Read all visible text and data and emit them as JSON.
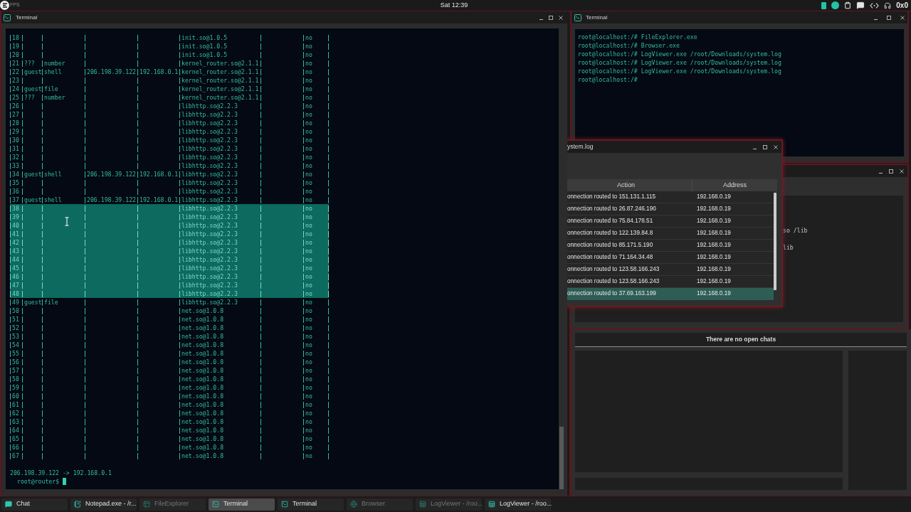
{
  "top_bar": {
    "fps_label": "FPS",
    "clock": "Sat 12:39",
    "status_text": "0x0"
  },
  "main_terminal": {
    "title": "Terminal",
    "rows": [
      {
        "column_1": "18",
        "column_6": "init.so@1.0.5",
        "column_8": "no",
        "selected": false
      },
      {
        "column_1": "19",
        "column_6": "init.so@1.0.5",
        "column_8": "no",
        "selected": false
      },
      {
        "column_1": "20",
        "column_6": "init.so@1.0.5",
        "column_8": "no",
        "selected": false
      },
      {
        "column_1": "21",
        "column_2": "???",
        "column_3": "number",
        "column_6": "kernel_router.so@2.1.1",
        "column_8": "no",
        "selected": false
      },
      {
        "column_1": "22",
        "column_2": "guest",
        "column_3": "shell",
        "column_4": "206.198.39.122",
        "column_5": "192.168.0.1",
        "column_6": "kernel_router.so@2.1.1",
        "column_8": "no",
        "selected": false
      },
      {
        "column_1": "23",
        "column_6": "kernel_router.so@2.1.1",
        "column_8": "no",
        "selected": false
      },
      {
        "column_1": "24",
        "column_2": "guest",
        "column_3": "file",
        "column_6": "kernel_router.so@2.1.1",
        "column_8": "no",
        "selected": false
      },
      {
        "column_1": "25",
        "column_2": "???",
        "column_3": "number",
        "column_6": "kernel_router.so@2.1.1",
        "column_8": "no",
        "selected": false
      },
      {
        "column_1": "26",
        "column_6": "libhttp.so@2.2.3",
        "column_8": "no",
        "selected": false
      },
      {
        "column_1": "27",
        "column_6": "libhttp.so@2.2.3",
        "column_8": "no",
        "selected": false
      },
      {
        "column_1": "28",
        "column_6": "libhttp.so@2.2.3",
        "column_8": "no",
        "selected": false
      },
      {
        "column_1": "29",
        "column_6": "libhttp.so@2.2.3",
        "column_8": "no",
        "selected": false
      },
      {
        "column_1": "30",
        "column_6": "libhttp.so@2.2.3",
        "column_8": "no",
        "selected": false
      },
      {
        "column_1": "31",
        "column_6": "libhttp.so@2.2.3",
        "column_8": "no",
        "selected": false
      },
      {
        "column_1": "32",
        "column_6": "libhttp.so@2.2.3",
        "column_8": "no",
        "selected": false
      },
      {
        "column_1": "33",
        "column_6": "libhttp.so@2.2.3",
        "column_8": "no",
        "selected": false
      },
      {
        "column_1": "34",
        "column_2": "guest",
        "column_3": "shell",
        "column_4": "206.198.39.122",
        "column_5": "192.168.0.1",
        "column_6": "libhttp.so@2.2.3",
        "column_8": "no",
        "selected": false
      },
      {
        "column_1": "35",
        "column_6": "libhttp.so@2.2.3",
        "column_8": "no",
        "selected": false
      },
      {
        "column_1": "36",
        "column_6": "libhttp.so@2.2.3",
        "column_8": "no",
        "selected": false
      },
      {
        "column_1": "37",
        "column_2": "guest",
        "column_3": "shell",
        "column_4": "206.198.39.122",
        "column_5": "192.168.0.1",
        "column_6": "libhttp.so@2.2.3",
        "column_8": "no",
        "selected": false
      },
      {
        "column_1": "38",
        "column_6": "libhttp.so@2.2.3",
        "column_8": "no",
        "selected": true
      },
      {
        "column_1": "39",
        "column_6": "libhttp.so@2.2.3",
        "column_8": "no",
        "selected": true
      },
      {
        "column_1": "40",
        "column_6": "libhttp.so@2.2.3",
        "column_8": "no",
        "selected": true
      },
      {
        "column_1": "41",
        "column_6": "libhttp.so@2.2.3",
        "column_8": "no",
        "selected": true
      },
      {
        "column_1": "42",
        "column_6": "libhttp.so@2.2.3",
        "column_8": "no",
        "selected": true
      },
      {
        "column_1": "43",
        "column_6": "libhttp.so@2.2.3",
        "column_8": "no",
        "selected": true
      },
      {
        "column_1": "44",
        "column_6": "libhttp.so@2.2.3",
        "column_8": "no",
        "selected": true
      },
      {
        "column_1": "45",
        "column_6": "libhttp.so@2.2.3",
        "column_8": "no",
        "selected": true
      },
      {
        "column_1": "46",
        "column_6": "libhttp.so@2.2.3",
        "column_8": "no",
        "selected": true
      },
      {
        "column_1": "47",
        "column_6": "libhttp.so@2.2.3",
        "column_8": "no",
        "selected": true
      },
      {
        "column_1": "48",
        "column_6": "libhttp.so@2.2.3",
        "column_8": "no",
        "selected": true
      },
      {
        "column_1": "49",
        "column_2": "guest",
        "column_3": "file",
        "column_6": "libhttp.so@2.2.3",
        "column_8": "no",
        "selected": false
      },
      {
        "column_1": "50",
        "column_6": "net.so@1.0.8",
        "column_8": "no",
        "selected": false
      },
      {
        "column_1": "51",
        "column_6": "net.so@1.0.8",
        "column_8": "no",
        "selected": false
      },
      {
        "column_1": "52",
        "column_6": "net.so@1.0.8",
        "column_8": "no",
        "selected": false
      },
      {
        "column_1": "53",
        "column_6": "net.so@1.0.8",
        "column_8": "no",
        "selected": false
      },
      {
        "column_1": "54",
        "column_6": "net.so@1.0.8",
        "column_8": "no",
        "selected": false
      },
      {
        "column_1": "55",
        "column_6": "net.so@1.0.8",
        "column_8": "no",
        "selected": false
      },
      {
        "column_1": "56",
        "column_6": "net.so@1.0.8",
        "column_8": "no",
        "selected": false
      },
      {
        "column_1": "57",
        "column_6": "net.so@1.0.8",
        "column_8": "no",
        "selected": false
      },
      {
        "column_1": "58",
        "column_6": "net.so@1.0.8",
        "column_8": "no",
        "selected": false
      },
      {
        "column_1": "59",
        "column_6": "net.so@1.0.8",
        "column_8": "no",
        "selected": false
      },
      {
        "column_1": "60",
        "column_6": "net.so@1.0.8",
        "column_8": "no",
        "selected": false
      },
      {
        "column_1": "61",
        "column_6": "net.so@1.0.8",
        "column_8": "no",
        "selected": false
      },
      {
        "column_1": "62",
        "column_6": "net.so@1.0.8",
        "column_8": "no",
        "selected": false
      },
      {
        "column_1": "63",
        "column_6": "net.so@1.0.8",
        "column_8": "no",
        "selected": false
      },
      {
        "column_1": "64",
        "column_6": "net.so@1.0.8",
        "column_8": "no",
        "selected": false
      },
      {
        "column_1": "65",
        "column_6": "net.so@1.0.8",
        "column_8": "no",
        "selected": false
      },
      {
        "column_1": "66",
        "column_6": "net.so@1.0.8",
        "column_8": "no",
        "selected": false
      },
      {
        "column_1": "67",
        "column_6": "net.so@1.0.8",
        "column_8": "no",
        "selected": false
      }
    ],
    "output": "206.198.39.122 -> 192.168.0.1",
    "prompt": "root@router$"
  },
  "side_terminal": {
    "title": "Terminal",
    "lines": [
      "root@localhost:/# FileExplorer.exe",
      "root@localhost:/# Browser.exe",
      "root@localhost:/# LogViewer.exe /root/Downloads/system.log",
      "root@localhost:/# LogViewer.exe /root/Downloads/system.log",
      "root@localhost:/# LogViewer.exe /root/Downloads/system.log",
      "root@localhost:/#"
    ]
  },
  "background_window": {
    "lines": [
      "so /lib",
      "lib"
    ]
  },
  "log_viewer": {
    "title": "ystem.log",
    "columns": [
      "Action",
      "Address"
    ],
    "rows": [
      {
        "action": "onnection routed to 151.131.1.115",
        "address": "192.168.0.19",
        "selected": false
      },
      {
        "action": "onnection routed to 26.87.246.190",
        "address": "192.168.0.19",
        "selected": false
      },
      {
        "action": "onnection routed to 75.84.178.51",
        "address": "192.168.0.19",
        "selected": false
      },
      {
        "action": "onnection routed to 122.139.84.8",
        "address": "192.168.0.19",
        "selected": false
      },
      {
        "action": "onnection routed to 85.171.5.190",
        "address": "192.168.0.19",
        "selected": false
      },
      {
        "action": "onnection routed to 71.164.34.48",
        "address": "192.168.0.19",
        "selected": false
      },
      {
        "action": "onnection routed to 123.58.166.243",
        "address": "192.168.0.19",
        "selected": false
      },
      {
        "action": "onnection routed to 123.58.166.243",
        "address": "192.168.0.19",
        "selected": false
      },
      {
        "action": "onnection routed to 37.69.163.199",
        "address": "192.168.0.19",
        "selected": true
      }
    ]
  },
  "chat_window": {
    "header": "There are no open chats"
  },
  "taskbar": {
    "items": [
      {
        "label": "Chat",
        "kind": "chat",
        "selected": false,
        "minimized": false
      },
      {
        "label": "Notepad.exe - /r...",
        "kind": "notepad",
        "selected": false,
        "minimized": false
      },
      {
        "label": "FileExplorer",
        "kind": "explorer",
        "selected": false,
        "minimized": true
      },
      {
        "label": "Terminal",
        "kind": "terminal",
        "selected": true,
        "minimized": false
      },
      {
        "label": "Terminal",
        "kind": "terminal",
        "selected": false,
        "minimized": false
      },
      {
        "label": "Browser",
        "kind": "browser",
        "selected": false,
        "minimized": true
      },
      {
        "label": "LogViewer - /roo...",
        "kind": "logviewer",
        "selected": false,
        "minimized": true
      },
      {
        "label": "LogViewer - /roo...",
        "kind": "logviewer",
        "selected": false,
        "minimized": false
      }
    ]
  }
}
